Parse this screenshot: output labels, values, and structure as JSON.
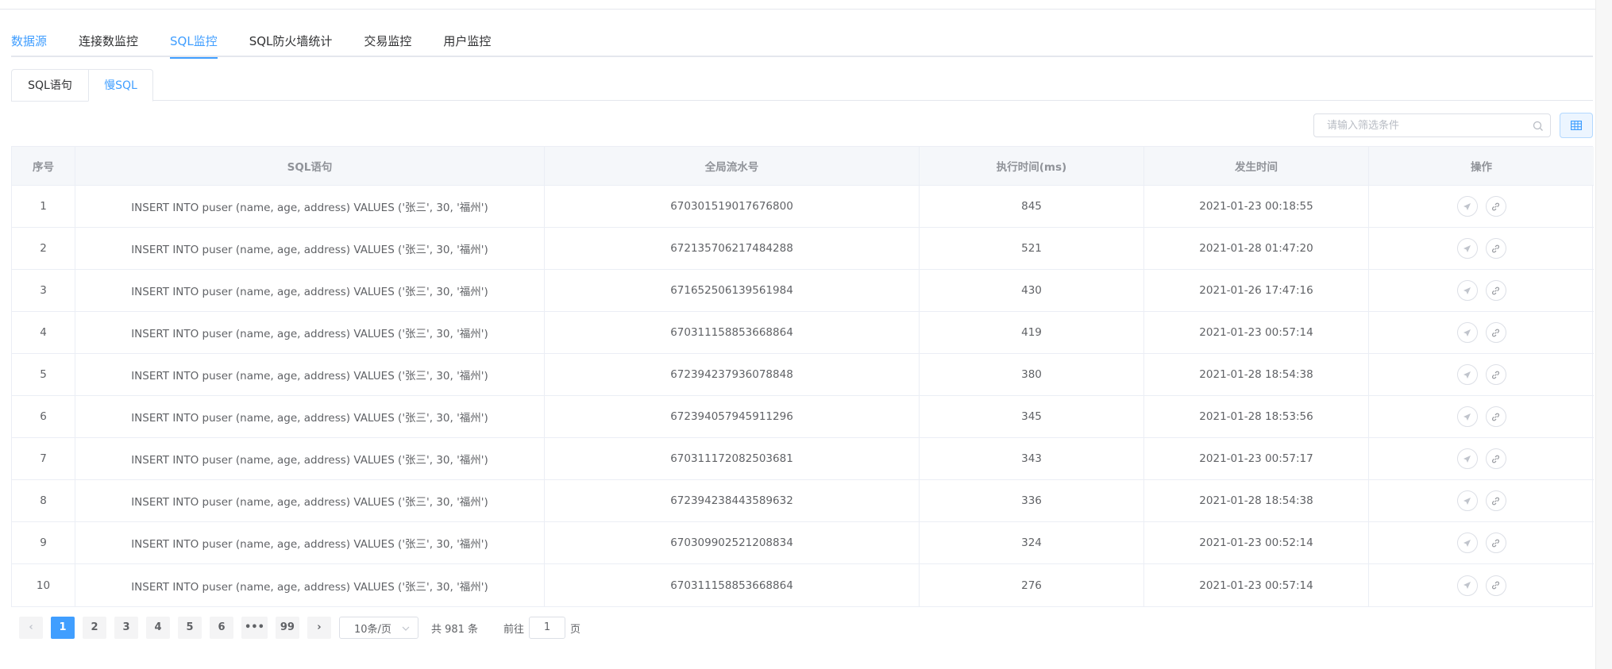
{
  "main_tabs": [
    {
      "label": "数据源"
    },
    {
      "label": "连接数监控"
    },
    {
      "label": "SQL监控"
    },
    {
      "label": "SQL防火墙统计"
    },
    {
      "label": "交易监控"
    },
    {
      "label": "用户监控"
    }
  ],
  "sub_tabs": [
    {
      "label": "SQL语句"
    },
    {
      "label": "慢SQL"
    }
  ],
  "search": {
    "placeholder": "请输入筛选条件"
  },
  "table": {
    "headers": [
      "序号",
      "SQL语句",
      "全局流水号",
      "执行时间(ms)",
      "发生时间",
      "操作"
    ],
    "rows": [
      {
        "no": "1",
        "sql": "INSERT INTO puser (name, age, address) VALUES ('张三', 30, '福州')",
        "serial": "670301519017676800",
        "ms": "845",
        "time": "2021-01-23 00:18:55"
      },
      {
        "no": "2",
        "sql": "INSERT INTO puser (name, age, address) VALUES ('张三', 30, '福州')",
        "serial": "672135706217484288",
        "ms": "521",
        "time": "2021-01-28 01:47:20"
      },
      {
        "no": "3",
        "sql": "INSERT INTO puser (name, age, address) VALUES ('张三', 30, '福州')",
        "serial": "671652506139561984",
        "ms": "430",
        "time": "2021-01-26 17:47:16"
      },
      {
        "no": "4",
        "sql": "INSERT INTO puser (name, age, address) VALUES ('张三', 30, '福州')",
        "serial": "670311158853668864",
        "ms": "419",
        "time": "2021-01-23 00:57:14"
      },
      {
        "no": "5",
        "sql": "INSERT INTO puser (name, age, address) VALUES ('张三', 30, '福州')",
        "serial": "672394237936078848",
        "ms": "380",
        "time": "2021-01-28 18:54:38"
      },
      {
        "no": "6",
        "sql": "INSERT INTO puser (name, age, address) VALUES ('张三', 30, '福州')",
        "serial": "672394057945911296",
        "ms": "345",
        "time": "2021-01-28 18:53:56"
      },
      {
        "no": "7",
        "sql": "INSERT INTO puser (name, age, address) VALUES ('张三', 30, '福州')",
        "serial": "670311172082503681",
        "ms": "343",
        "time": "2021-01-23 00:57:17"
      },
      {
        "no": "8",
        "sql": "INSERT INTO puser (name, age, address) VALUES ('张三', 30, '福州')",
        "serial": "672394238443589632",
        "ms": "336",
        "time": "2021-01-28 18:54:38"
      },
      {
        "no": "9",
        "sql": "INSERT INTO puser (name, age, address) VALUES ('张三', 30, '福州')",
        "serial": "670309902521208834",
        "ms": "324",
        "time": "2021-01-23 00:52:14"
      },
      {
        "no": "10",
        "sql": "INSERT INTO puser (name, age, address) VALUES ('张三', 30, '福州')",
        "serial": "670311158853668864",
        "ms": "276",
        "time": "2021-01-23 00:57:14"
      }
    ]
  },
  "pagination": {
    "prev": "‹",
    "pages": [
      "1",
      "2",
      "3",
      "4",
      "5",
      "6",
      "•••",
      "99"
    ],
    "next": "›",
    "page_size": "10条/页",
    "total": "共 981 条",
    "goto_label": "前往",
    "goto_value": "1",
    "goto_suffix": "页"
  },
  "colors": {
    "accent": "#409eff",
    "border": "#ebeef5",
    "header_bg": "#f5f7fa"
  }
}
